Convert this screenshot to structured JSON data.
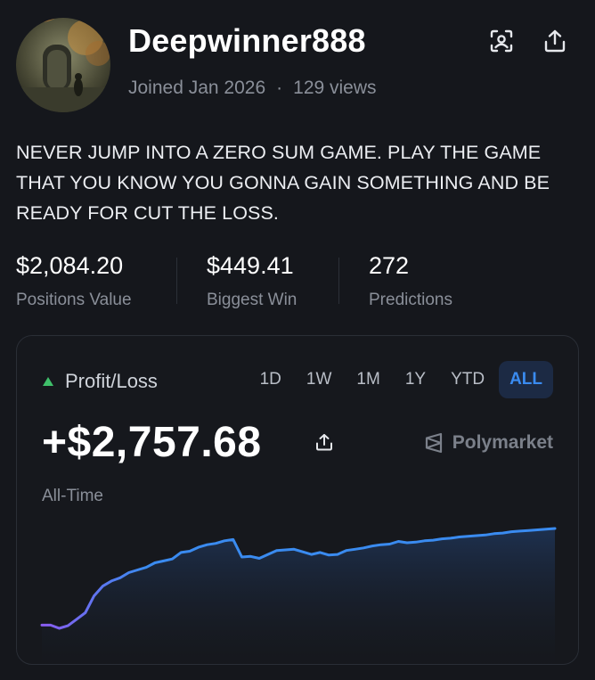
{
  "profile": {
    "username": "Deepwinner888",
    "joined": "Joined Jan 2026",
    "views": "129 views",
    "bio": "NEVER JUMP INTO A ZERO SUM GAME. PLAY THE GAME THAT YOU KNOW YOU GONNA GAIN SOMETHING AND BE READY FOR CUT THE LOSS."
  },
  "icons": {
    "scan": "qr-scan-icon",
    "share": "share-icon"
  },
  "stats": [
    {
      "value": "$2,084.20",
      "label": "Positions Value"
    },
    {
      "value": "$449.41",
      "label": "Biggest Win"
    },
    {
      "value": "272",
      "label": "Predictions"
    }
  ],
  "pnl": {
    "title": "Profit/Loss",
    "ranges": [
      "1D",
      "1W",
      "1M",
      "1Y",
      "YTD",
      "ALL"
    ],
    "active_range": "ALL",
    "amount": "+$2,757.68",
    "period": "All-Time",
    "brand": "Polymarket"
  },
  "colors": {
    "accent": "#3a8bf0",
    "up_green": "#3fbf6a",
    "line_start": "#8a5cf0",
    "line_end": "#3a8bf0"
  },
  "chart_data": {
    "type": "area",
    "title": "",
    "xlabel": "",
    "ylabel": "",
    "grid": false,
    "x": [
      0,
      1,
      2,
      3,
      4,
      5,
      6,
      7,
      8,
      9,
      10,
      11,
      12,
      13,
      14,
      15,
      16,
      17,
      18,
      19,
      20,
      21,
      22,
      23,
      24,
      25,
      26,
      27,
      28,
      29,
      30,
      31,
      32,
      33,
      34,
      35,
      36,
      37,
      38,
      39,
      40,
      41,
      42,
      43,
      44,
      45,
      46,
      47,
      48,
      49,
      50,
      51,
      52,
      53,
      54,
      55,
      56,
      57,
      58,
      59
    ],
    "series": [
      {
        "values": [
          20,
          20,
          -30,
          10,
          110,
          210,
          470,
          620,
          700,
          750,
          830,
          870,
          910,
          980,
          1010,
          1040,
          1140,
          1160,
          1220,
          1260,
          1280,
          1320,
          1340,
          1070,
          1080,
          1050,
          1110,
          1170,
          1180,
          1190,
          1150,
          1110,
          1140,
          1100,
          1110,
          1170,
          1190,
          1210,
          1240,
          1260,
          1270,
          1310,
          1290,
          1300,
          1320,
          1330,
          1350,
          1360,
          1380,
          1390,
          1400,
          1410,
          1430,
          1440,
          1460,
          1470,
          1480,
          1490,
          1500,
          1510
        ]
      }
    ]
  }
}
